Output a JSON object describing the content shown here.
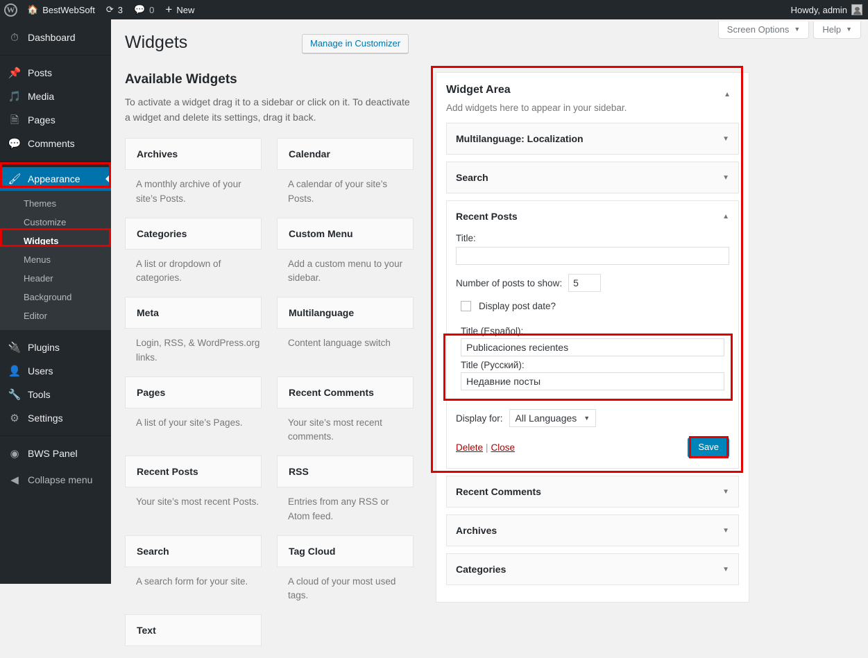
{
  "adminbar": {
    "logo_icon": "wordpress-logo-icon",
    "site_icon": "home-icon",
    "site_name": "BestWebSoft",
    "updates_icon": "updates-icon",
    "updates_count": "3",
    "comments_icon": "comment-bubble-icon",
    "comments_count": "0",
    "new_icon": "plus-icon",
    "new_label": "New",
    "howdy": "Howdy, admin",
    "avatar_icon": "user-avatar-icon"
  },
  "sidebar": {
    "items": [
      {
        "label": "Dashboard",
        "icon": "dashboard-icon",
        "key": "dashboard"
      },
      {
        "label": "Posts",
        "icon": "pin-icon",
        "key": "posts"
      },
      {
        "label": "Media",
        "icon": "media-icon",
        "key": "media"
      },
      {
        "label": "Pages",
        "icon": "pages-icon",
        "key": "pages"
      },
      {
        "label": "Comments",
        "icon": "comment-bubble-icon",
        "key": "comments"
      },
      {
        "label": "Appearance",
        "icon": "paintbrush-icon",
        "key": "appearance"
      },
      {
        "label": "Plugins",
        "icon": "plug-icon",
        "key": "plugins"
      },
      {
        "label": "Users",
        "icon": "user-icon",
        "key": "users"
      },
      {
        "label": "Tools",
        "icon": "wrench-icon",
        "key": "tools"
      },
      {
        "label": "Settings",
        "icon": "sliders-icon",
        "key": "settings"
      },
      {
        "label": "BWS Panel",
        "icon": "bws-icon",
        "key": "bws-panel"
      },
      {
        "label": "Collapse menu",
        "icon": "collapse-arrow-icon",
        "key": "collapse"
      }
    ],
    "appearance_submenu": [
      {
        "label": "Themes",
        "current": false
      },
      {
        "label": "Customize",
        "current": false
      },
      {
        "label": "Widgets",
        "current": true
      },
      {
        "label": "Menus",
        "current": false
      },
      {
        "label": "Header",
        "current": false
      },
      {
        "label": "Background",
        "current": false
      },
      {
        "label": "Editor",
        "current": false
      }
    ],
    "active_item": "Appearance",
    "active_color": "#0073aa"
  },
  "screen_meta": {
    "screen_options": "Screen Options",
    "help": "Help",
    "caret_icon": "chevron-down-icon"
  },
  "page": {
    "title": "Widgets",
    "manage_in_customizer": "Manage in Customizer"
  },
  "available_widgets": {
    "heading": "Available Widgets",
    "description": "To activate a widget drag it to a sidebar or click on it. To deactivate a widget and delete its settings, drag it back.",
    "items": [
      {
        "name": "Archives",
        "desc": "A monthly archive of your site’s Posts."
      },
      {
        "name": "Calendar",
        "desc": "A calendar of your site’s Posts."
      },
      {
        "name": "Categories",
        "desc": "A list or dropdown of categories."
      },
      {
        "name": "Custom Menu",
        "desc": "Add a custom menu to your sidebar."
      },
      {
        "name": "Meta",
        "desc": "Login, RSS, & WordPress.org links."
      },
      {
        "name": "Multilanguage",
        "desc": "Content language switch"
      },
      {
        "name": "Pages",
        "desc": "A list of your site’s Pages."
      },
      {
        "name": "Recent Comments",
        "desc": "Your site’s most recent comments."
      },
      {
        "name": "Recent Posts",
        "desc": "Your site’s most recent Posts."
      },
      {
        "name": "RSS",
        "desc": "Entries from any RSS or Atom feed."
      },
      {
        "name": "Search",
        "desc": "A search form for your site."
      },
      {
        "name": "Tag Cloud",
        "desc": "A cloud of your most used tags."
      },
      {
        "name": "Text",
        "desc": ""
      }
    ]
  },
  "widget_area": {
    "title": "Widget Area",
    "description": "Add widgets here to appear in your sidebar.",
    "collapse_icon": "chevron-up-icon",
    "expand_icon": "chevron-down-icon",
    "widgets": [
      {
        "title": "Multilanguage: Localization",
        "open": false
      },
      {
        "title": "Search",
        "open": false
      },
      {
        "title": "Recent Posts",
        "open": true
      },
      {
        "title": "Recent Comments",
        "open": false
      },
      {
        "title": "Archives",
        "open": false
      },
      {
        "title": "Categories",
        "open": false
      }
    ],
    "recent_posts_form": {
      "title_label": "Title:",
      "title_value": "",
      "title_placeholder": "",
      "number_label": "Number of posts to show:",
      "number_value": "5",
      "display_date_label": "Display post date?",
      "display_date_checked": false,
      "title_es_label": "Title (Español):",
      "title_es_value": "Publicaciones recientes",
      "title_ru_label": "Title (Русский):",
      "title_ru_value": "Недавние посты",
      "display_for_label": "Display for:",
      "display_for_value": "All Languages",
      "delete_label": "Delete",
      "separator": "|",
      "close_label": "Close",
      "save_label": "Save"
    }
  },
  "annotations": {
    "color": "#e50000",
    "boxes": [
      "appearance-menu-item",
      "widgets-submenu-item",
      "widget-area-panel",
      "multilanguage-title-fields",
      "save-button"
    ]
  }
}
